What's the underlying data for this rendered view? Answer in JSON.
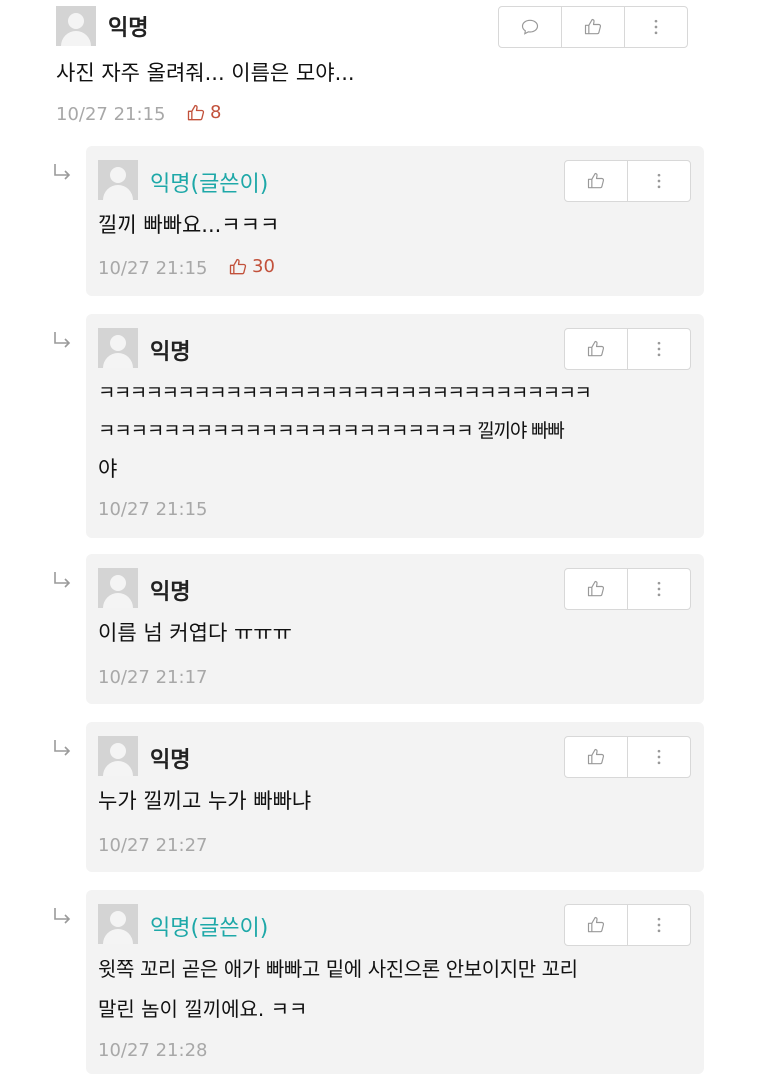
{
  "root_comment": {
    "author": "익명",
    "text": "사진 자주 올려줘... 이름은 모야...",
    "time": "10/27 21:15",
    "likes": "8",
    "icons": [
      "comment-icon",
      "thumbs-up-icon",
      "more-vertical-icon"
    ]
  },
  "replies": [
    {
      "author": "익명(글쓴이)",
      "is_op": true,
      "lines": [
        "낄끼 빠빠요...ㅋㅋㅋ"
      ],
      "time": "10/27 21:15",
      "likes": "30"
    },
    {
      "author": "익명",
      "is_op": false,
      "lines": [
        "ㅋㅋㅋㅋㅋㅋㅋㅋㅋㅋㅋㅋㅋㅋㅋㅋㅋㅋㅋㅋㅋㅋㅋㅋㅋㅋㅋㅋㅋㅋㅋ",
        "ㅋㅋㅋㅋㅋㅋㅋㅋㅋㅋㅋㅋㅋㅋㅋㅋㅋㅋㅋㅋㅋㅋㅋ 낄끼야 빠빠",
        "야"
      ],
      "time": "10/27 21:15",
      "likes": ""
    },
    {
      "author": "익명",
      "is_op": false,
      "lines": [
        "이름 넘 커엽다 ㅠㅠㅠ"
      ],
      "time": "10/27 21:17",
      "likes": ""
    },
    {
      "author": "익명",
      "is_op": false,
      "lines": [
        "누가 낄끼고 누가 빠빠냐"
      ],
      "time": "10/27 21:27",
      "likes": ""
    },
    {
      "author": "익명(글쓴이)",
      "is_op": true,
      "lines": [
        "윗쪽 꼬리 곧은 애가 빠빠고 밑에 사진으론 안보이지만 꼬리",
        "말린 놈이 낄끼에요. ㅋㅋ"
      ],
      "time": "10/27 21:28",
      "likes": ""
    }
  ],
  "colors": {
    "op_author": "#1ea8a8",
    "likes": "#c2513b",
    "card_bg": "#f3f3f3",
    "time": "#a8a8a8"
  }
}
